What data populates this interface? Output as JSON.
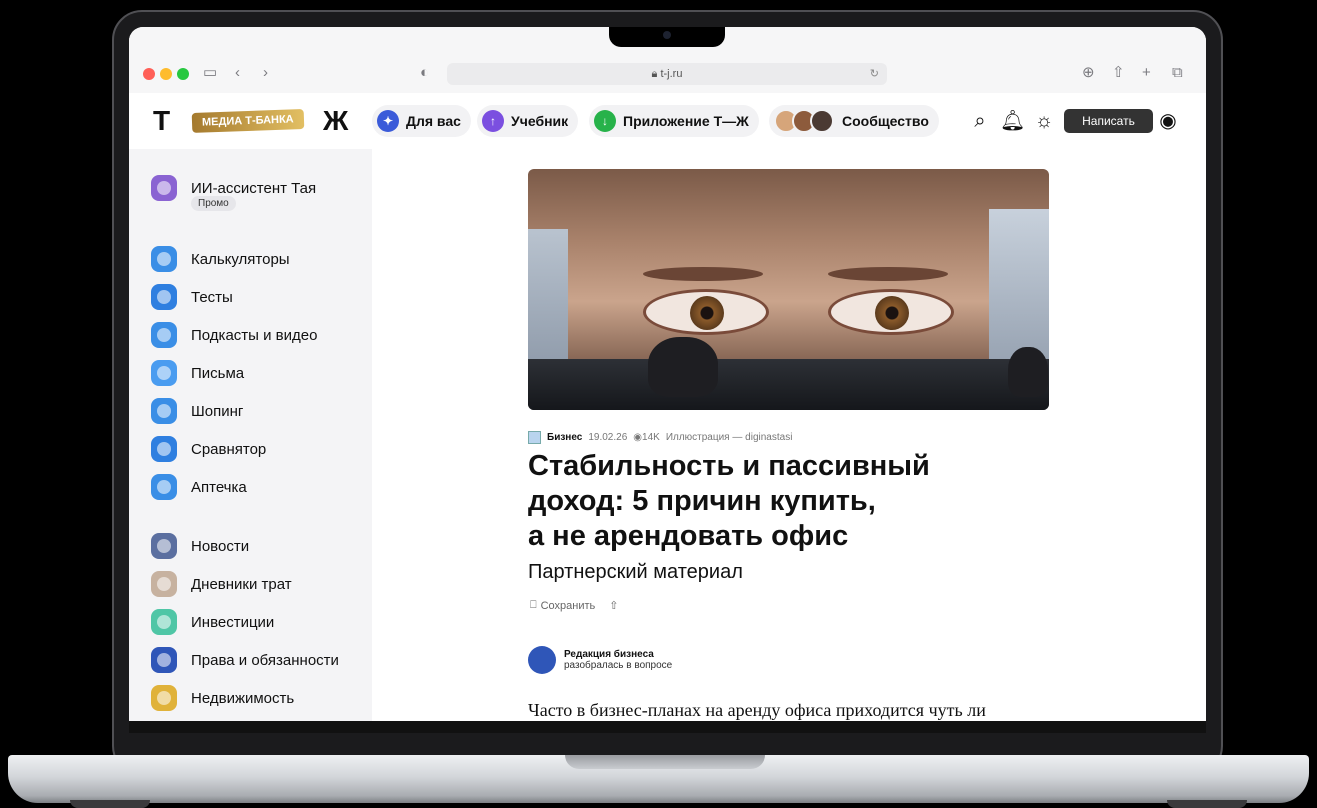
{
  "browser": {
    "url": "t-j.ru"
  },
  "header": {
    "logo_pill": "МЕДИА Т-БАНКА",
    "logo_left": "Т",
    "logo_right": "Ж",
    "nav": [
      "Для вас",
      "Учебник",
      "Приложение Т—Ж",
      "Сообщество"
    ],
    "write_label": "Написать"
  },
  "sidebar": {
    "assistant": {
      "label": "ИИ-ассистент Тая",
      "badge": "Промо"
    },
    "group1": [
      "Калькуляторы",
      "Тесты",
      "Подкасты и видео",
      "Письма",
      "Шопинг",
      "Сравнятор",
      "Аптечка"
    ],
    "group2": [
      "Новости",
      "Дневники трат",
      "Инвестиции",
      "Права и обязанности",
      "Недвижимость"
    ]
  },
  "article": {
    "category": "Бизнес",
    "date": "19.02.26",
    "views": "14K",
    "credit": "Иллюстрация — diginastasi",
    "title_lines": [
      "Стабильность и пассивный",
      "доход: 5 причин купить,",
      "а не арендовать офис"
    ],
    "subtitle": "Партнерский материал",
    "save_label": "Сохранить",
    "author_name": "Редакция бизнеса",
    "author_role": "разобралась в вопросе",
    "body_start": "Часто в бизнес-планах на аренду офиса приходится чуть ли"
  },
  "colors": {
    "accent_blue": "#3b5bd9",
    "accent_purple": "#7b4fe0",
    "accent_green": "#27b24a",
    "logo_gold": "#c9a14a"
  }
}
